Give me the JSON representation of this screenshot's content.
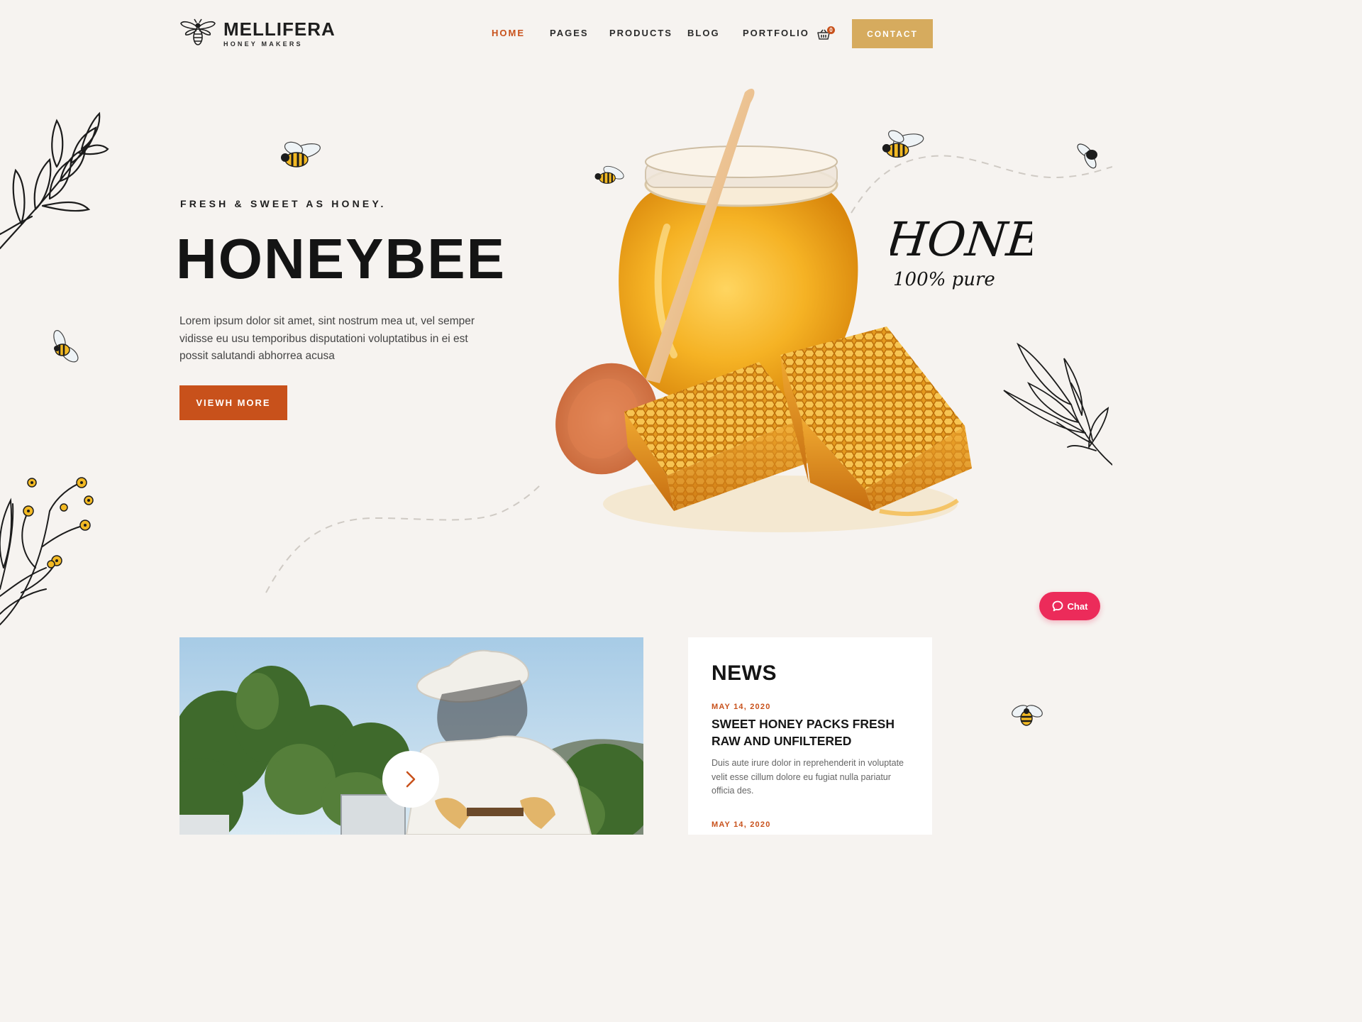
{
  "brand": {
    "name": "MELLIFERA",
    "tagline": "HONEY MAKERS"
  },
  "nav": {
    "items": [
      {
        "label": "HOME",
        "active": true
      },
      {
        "label": "PAGES"
      },
      {
        "label": "PRODUCTS"
      },
      {
        "label": "BLOG"
      },
      {
        "label": "PORTFOLIO"
      }
    ],
    "cart_count": "0",
    "contact_label": "CONTACT"
  },
  "hero": {
    "kicker": "FRESH & SWEET AS HONEY.",
    "title": "HONEYBEE",
    "text": "Lorem ipsum dolor sit amet, sint nostrum mea ut, vel semper vidisse eu usu temporibus disputationi voluptatibus in ei est possit salutandi abhorrea acusa",
    "cta_label": "VIEWH MORE",
    "script_main": "HONEY",
    "script_sub": "100% pure"
  },
  "chat": {
    "label": "Chat"
  },
  "news": {
    "title": "NEWS",
    "items": [
      {
        "date": "MAY 14, 2020",
        "headline": "SWEET HONEY PACKS FRESH RAW AND UNFILTERED",
        "excerpt": "Duis aute irure dolor in reprehenderit in voluptate velit esse cillum dolore eu fugiat nulla pariatur officia des."
      },
      {
        "date": "MAY 14, 2020"
      }
    ]
  },
  "colors": {
    "accent": "#c8511b",
    "gold": "#d6ab5e",
    "background": "#f6f3f0",
    "chat": "#ec2b5a"
  },
  "icons": [
    "bee-logo-icon",
    "cart-icon",
    "chat-bubble-icon",
    "chevron-right-icon",
    "bee-icon"
  ]
}
